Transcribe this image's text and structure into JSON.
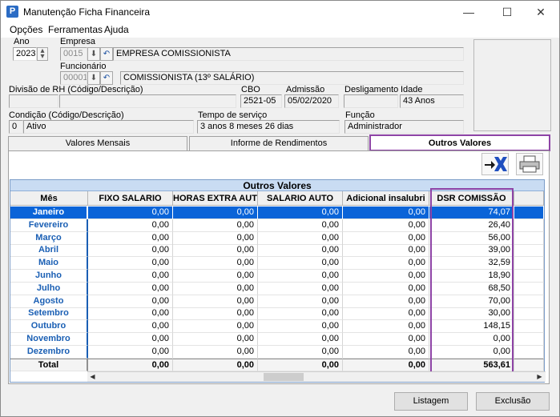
{
  "window": {
    "title": "Manutenção Ficha Financeira"
  },
  "menu": [
    "Opções",
    "Ferramentas",
    "Ajuda"
  ],
  "form": {
    "ano_label": "Ano",
    "ano_value": "2023",
    "empresa_label": "Empresa",
    "empresa_code": "0015",
    "empresa_name": "EMPRESA COMISSIONISTA",
    "funcionario_label": "Funcionário",
    "funcionario_code": "00001",
    "funcionario_name": "COMISSIONISTA  (13º SALÁRIO)",
    "divisao_label": "Divisão de RH (Código/Descrição)",
    "cbo_label": "CBO",
    "cbo_value": "2521-05",
    "admissao_label": "Admissão",
    "admissao_value": "05/02/2020",
    "desligamento_label": "Desligamento",
    "idade_label": "Idade",
    "idade_value": "43 Anos",
    "condicao_label": "Condição (Código/Descrição)",
    "condicao_code": "0",
    "condicao_desc": "Ativo",
    "tempo_label": "Tempo de serviço",
    "tempo_value": "3 anos 8 meses 26 dias",
    "funcao_label": "Função",
    "funcao_value": "Administrador"
  },
  "tabs": [
    "Valores Mensais",
    "Informe de Rendimentos",
    "Outros Valores"
  ],
  "grid": {
    "title": "Outros Valores",
    "columns": [
      "Mês",
      "FIXO SALARIO",
      "HORAS EXTRA AUTO",
      "SALARIO AUTO",
      "Adicional insalubri",
      "DSR COMISSÃO"
    ],
    "rows": [
      {
        "mes": "Janeiro",
        "v": [
          "0,00",
          "0,00",
          "0,00",
          "0,00",
          "74,07"
        ]
      },
      {
        "mes": "Fevereiro",
        "v": [
          "0,00",
          "0,00",
          "0,00",
          "0,00",
          "26,40"
        ]
      },
      {
        "mes": "Março",
        "v": [
          "0,00",
          "0,00",
          "0,00",
          "0,00",
          "56,00"
        ]
      },
      {
        "mes": "Abril",
        "v": [
          "0,00",
          "0,00",
          "0,00",
          "0,00",
          "39,00"
        ]
      },
      {
        "mes": "Maio",
        "v": [
          "0,00",
          "0,00",
          "0,00",
          "0,00",
          "32,59"
        ]
      },
      {
        "mes": "Junho",
        "v": [
          "0,00",
          "0,00",
          "0,00",
          "0,00",
          "18,90"
        ]
      },
      {
        "mes": "Julho",
        "v": [
          "0,00",
          "0,00",
          "0,00",
          "0,00",
          "68,50"
        ]
      },
      {
        "mes": "Agosto",
        "v": [
          "0,00",
          "0,00",
          "0,00",
          "0,00",
          "70,00"
        ]
      },
      {
        "mes": "Setembro",
        "v": [
          "0,00",
          "0,00",
          "0,00",
          "0,00",
          "30,00"
        ]
      },
      {
        "mes": "Outubro",
        "v": [
          "0,00",
          "0,00",
          "0,00",
          "0,00",
          "148,15"
        ]
      },
      {
        "mes": "Novembro",
        "v": [
          "0,00",
          "0,00",
          "0,00",
          "0,00",
          "0,00"
        ]
      },
      {
        "mes": "Dezembro",
        "v": [
          "0,00",
          "0,00",
          "0,00",
          "0,00",
          "0,00"
        ]
      }
    ],
    "total": {
      "label": "Total",
      "v": [
        "0,00",
        "0,00",
        "0,00",
        "0,00",
        "563,61"
      ]
    }
  },
  "buttons": {
    "listagem": "Listagem",
    "exclusao": "Exclusão"
  },
  "colors": {
    "highlight": "#8e44a6",
    "selection": "#0a64d8",
    "month_text": "#1a5fb4"
  }
}
